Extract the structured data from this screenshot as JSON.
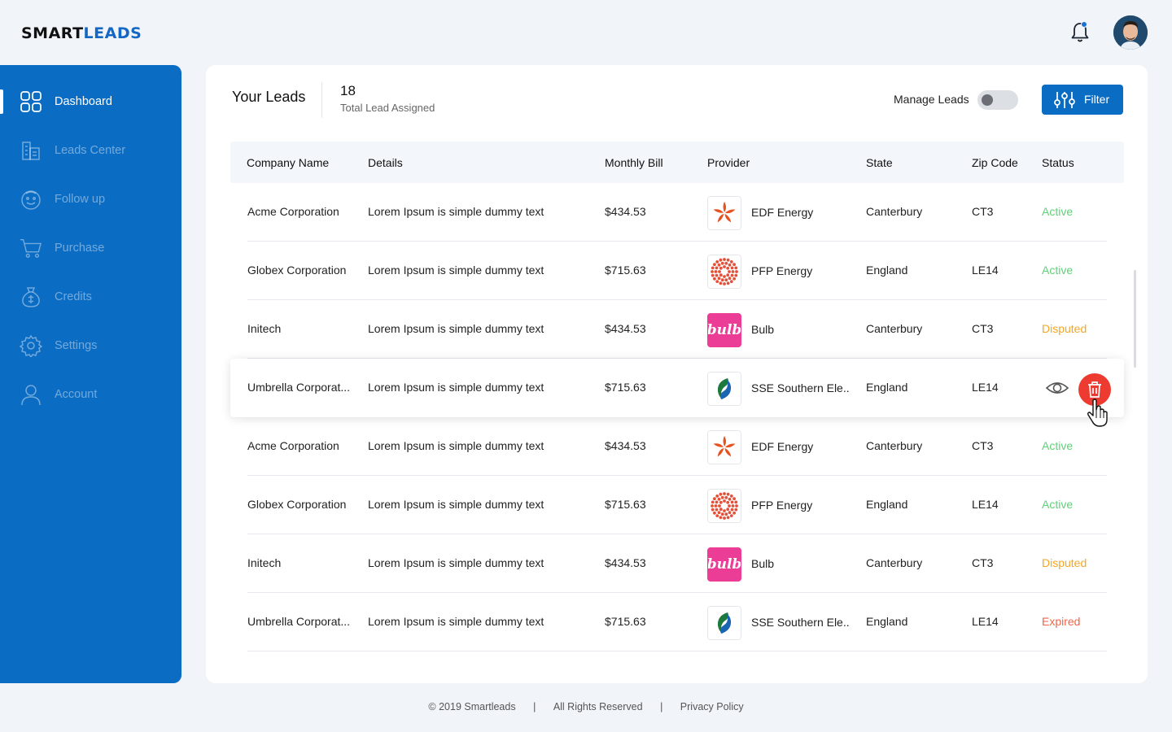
{
  "brand": {
    "part1": "SMART",
    "part2": "LEADS"
  },
  "colors": {
    "primary": "#0b6cc3",
    "active": "#5fd27a",
    "disputed": "#f5a623",
    "expired": "#f0664a",
    "delete": "#ee3b32"
  },
  "sidebar": {
    "items": [
      {
        "label": "Dashboard",
        "icon": "dashboard-grid-icon"
      },
      {
        "label": "Leads Center",
        "icon": "buildings-icon"
      },
      {
        "label": "Follow up",
        "icon": "face-icon"
      },
      {
        "label": "Purchase",
        "icon": "cart-icon"
      },
      {
        "label": "Credits",
        "icon": "money-bag-icon"
      },
      {
        "label": "Settings",
        "icon": "gear-icon"
      },
      {
        "label": "Account",
        "icon": "user-icon"
      }
    ]
  },
  "header": {
    "title": "Your Leads",
    "count": "18",
    "count_label": "Total Lead Assigned",
    "manage_label": "Manage Leads",
    "filter_label": "Filter"
  },
  "table": {
    "columns": [
      "Company Name",
      "Details",
      "Monthly Bill",
      "Provider",
      "State",
      "Zip Code",
      "Status"
    ],
    "rows": [
      {
        "company": "Acme Corporation",
        "details": "Lorem Ipsum is simple dummy text",
        "bill": "$434.53",
        "provider": "EDF Energy",
        "logo": "edf",
        "state": "Canterbury",
        "zip": "CT3",
        "status": "Active"
      },
      {
        "company": "Globex Corporation",
        "details": "Lorem Ipsum is simple dummy text",
        "bill": "$715.63",
        "provider": "PFP Energy",
        "logo": "pfp",
        "state": "England",
        "zip": "LE14",
        "status": "Active"
      },
      {
        "company": "Initech",
        "details": "Lorem Ipsum is simple dummy text",
        "bill": "$434.53",
        "provider": "Bulb",
        "logo": "bulb",
        "state": "Canterbury",
        "zip": "CT3",
        "status": "Disputed"
      },
      {
        "company": "Umbrella Corporat...",
        "details": "Lorem Ipsum is simple dummy text",
        "bill": "$715.63",
        "provider": "SSE Southern Ele..",
        "logo": "sse",
        "state": "England",
        "zip": "LE14",
        "status": ""
      },
      {
        "company": "Acme Corporation",
        "details": "Lorem Ipsum is simple dummy text",
        "bill": "$434.53",
        "provider": "EDF Energy",
        "logo": "edf",
        "state": "Canterbury",
        "zip": "CT3",
        "status": "Active"
      },
      {
        "company": "Globex Corporation",
        "details": "Lorem Ipsum is simple dummy text",
        "bill": "$715.63",
        "provider": "PFP Energy",
        "logo": "pfp",
        "state": "England",
        "zip": "LE14",
        "status": "Active"
      },
      {
        "company": "Initech",
        "details": "Lorem Ipsum is simple dummy text",
        "bill": "$434.53",
        "provider": "Bulb",
        "logo": "bulb",
        "state": "Canterbury",
        "zip": "CT3",
        "status": "Disputed"
      },
      {
        "company": "Umbrella Corporat...",
        "details": "Lorem Ipsum is simple dummy text",
        "bill": "$715.63",
        "provider": "SSE Southern Ele..",
        "logo": "sse",
        "state": "England",
        "zip": "LE14",
        "status": "Expired"
      }
    ]
  },
  "footer": {
    "copyright": "© 2019 Smartleads",
    "rights": "All Rights Reserved",
    "privacy": "Privacy Policy",
    "separator": "|"
  }
}
